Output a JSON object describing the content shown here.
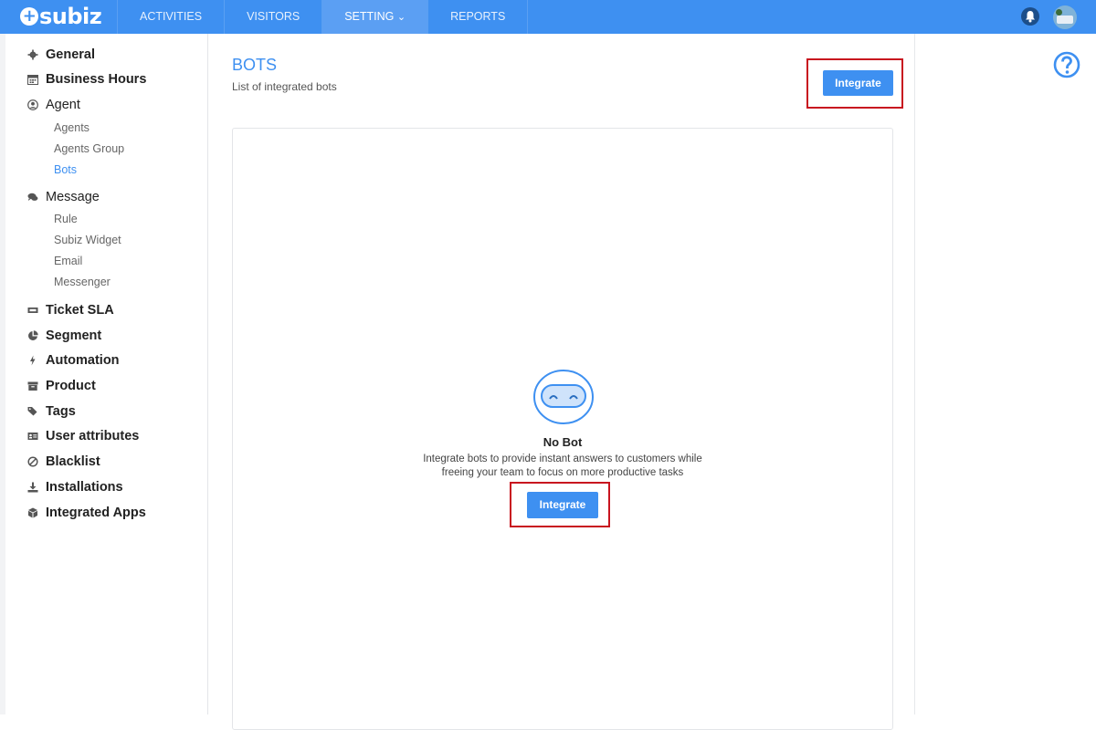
{
  "app": {
    "logo": "subiz"
  },
  "nav": [
    {
      "label": "ACTIVITIES"
    },
    {
      "label": "VISITORS"
    },
    {
      "label": "SETTING",
      "suffix": "⌄"
    },
    {
      "label": "REPORTS"
    }
  ],
  "sidebar": {
    "general": "General",
    "business_hours": "Business Hours",
    "agent": "Agent",
    "agents": "Agents",
    "agents_group": "Agents Group",
    "bots": "Bots",
    "message": "Message",
    "rule": "Rule",
    "subiz_widget": "Subiz Widget",
    "email": "Email",
    "messenger": "Messenger",
    "ticket_sla": "Ticket SLA",
    "segment": "Segment",
    "automation": "Automation",
    "product": "Product",
    "tags": "Tags",
    "user_attributes": "User attributes",
    "blacklist": "Blacklist",
    "installations": "Installations",
    "integrated_apps": "Integrated Apps"
  },
  "main": {
    "title": "BOTS",
    "subtitle": "List of integrated bots",
    "integrate_button": "Integrate",
    "empty": {
      "heading": "No Bot",
      "line1": "Integrate bots to provide instant answers to customers while",
      "line2": "freeing your team to focus on more productive tasks",
      "button": "Integrate"
    }
  },
  "colors": {
    "brand": "#3e90f1",
    "highlight": "#c8141f"
  },
  "icons": [
    "gear-icon",
    "calendar-icon",
    "user-circle-icon",
    "chat-icon",
    "ticket-icon",
    "pie-icon",
    "bolt-icon",
    "box-icon",
    "tag-icon",
    "id-card-icon",
    "ban-icon",
    "download-icon",
    "cube-icon",
    "bot-icon",
    "help-icon",
    "bell-icon"
  ]
}
